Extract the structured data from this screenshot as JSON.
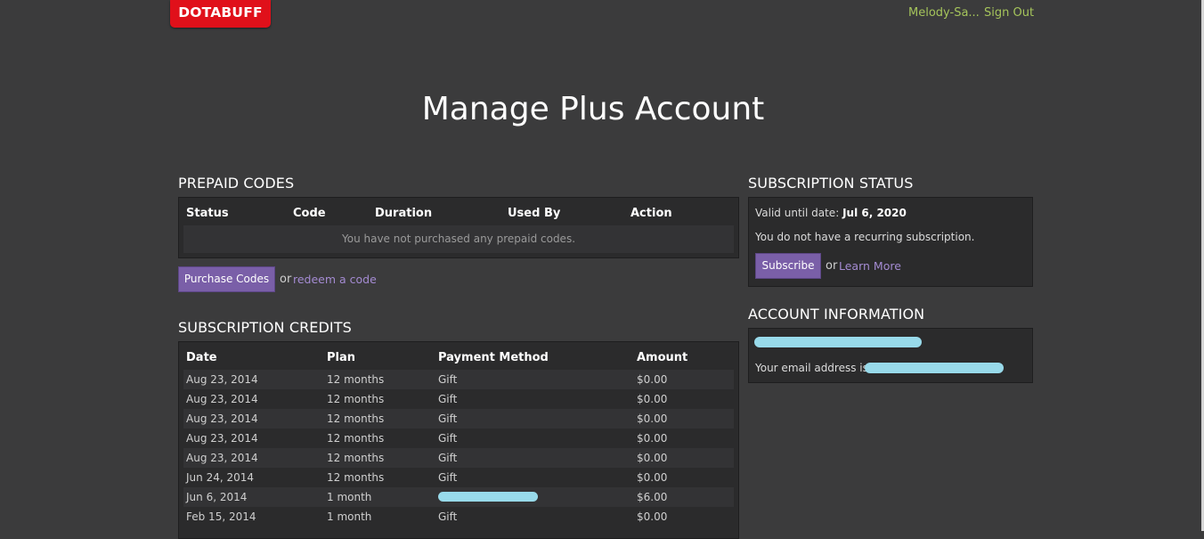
{
  "header": {
    "logo": "DOTABUFF",
    "user": "Melody-Sa...",
    "sign_out": "Sign Out"
  },
  "page_title": "Manage Plus Account",
  "prepaid": {
    "title": "PREPAID CODES",
    "columns": [
      "Status",
      "Code",
      "Duration",
      "Used By",
      "Action"
    ],
    "empty_text": "You have not purchased any prepaid codes.",
    "purchase_button": "Purchase Codes",
    "or": "or",
    "redeem_link": "redeem a code"
  },
  "credits": {
    "title": "SUBSCRIPTION CREDITS",
    "columns": [
      "Date",
      "Plan",
      "Payment Method",
      "Amount"
    ],
    "rows": [
      {
        "date": "Aug 23, 2014",
        "plan": "12 months",
        "method": "Gift",
        "amount": "$0.00"
      },
      {
        "date": "Aug 23, 2014",
        "plan": "12 months",
        "method": "Gift",
        "amount": "$0.00"
      },
      {
        "date": "Aug 23, 2014",
        "plan": "12 months",
        "method": "Gift",
        "amount": "$0.00"
      },
      {
        "date": "Aug 23, 2014",
        "plan": "12 months",
        "method": "Gift",
        "amount": "$0.00"
      },
      {
        "date": "Aug 23, 2014",
        "plan": "12 months",
        "method": "Gift",
        "amount": "$0.00"
      },
      {
        "date": "Jun 24, 2014",
        "plan": "12 months",
        "method": "Gift",
        "amount": "$0.00"
      },
      {
        "date": "Jun 6, 2014",
        "plan": "1 month",
        "method": "",
        "amount": "$6.00"
      },
      {
        "date": "Feb 15, 2014",
        "plan": "1 month",
        "method": "Gift",
        "amount": "$0.00"
      }
    ]
  },
  "status": {
    "title": "SUBSCRIPTION STATUS",
    "valid_label": "Valid until date:",
    "valid_date": "Jul 6, 2020",
    "recurring_text": "You do not have a recurring subscription.",
    "subscribe_button": "Subscribe",
    "or": "or",
    "learn_more": "Learn More"
  },
  "account": {
    "title": "ACCOUNT INFORMATION",
    "email_label": "Your email address is"
  }
}
